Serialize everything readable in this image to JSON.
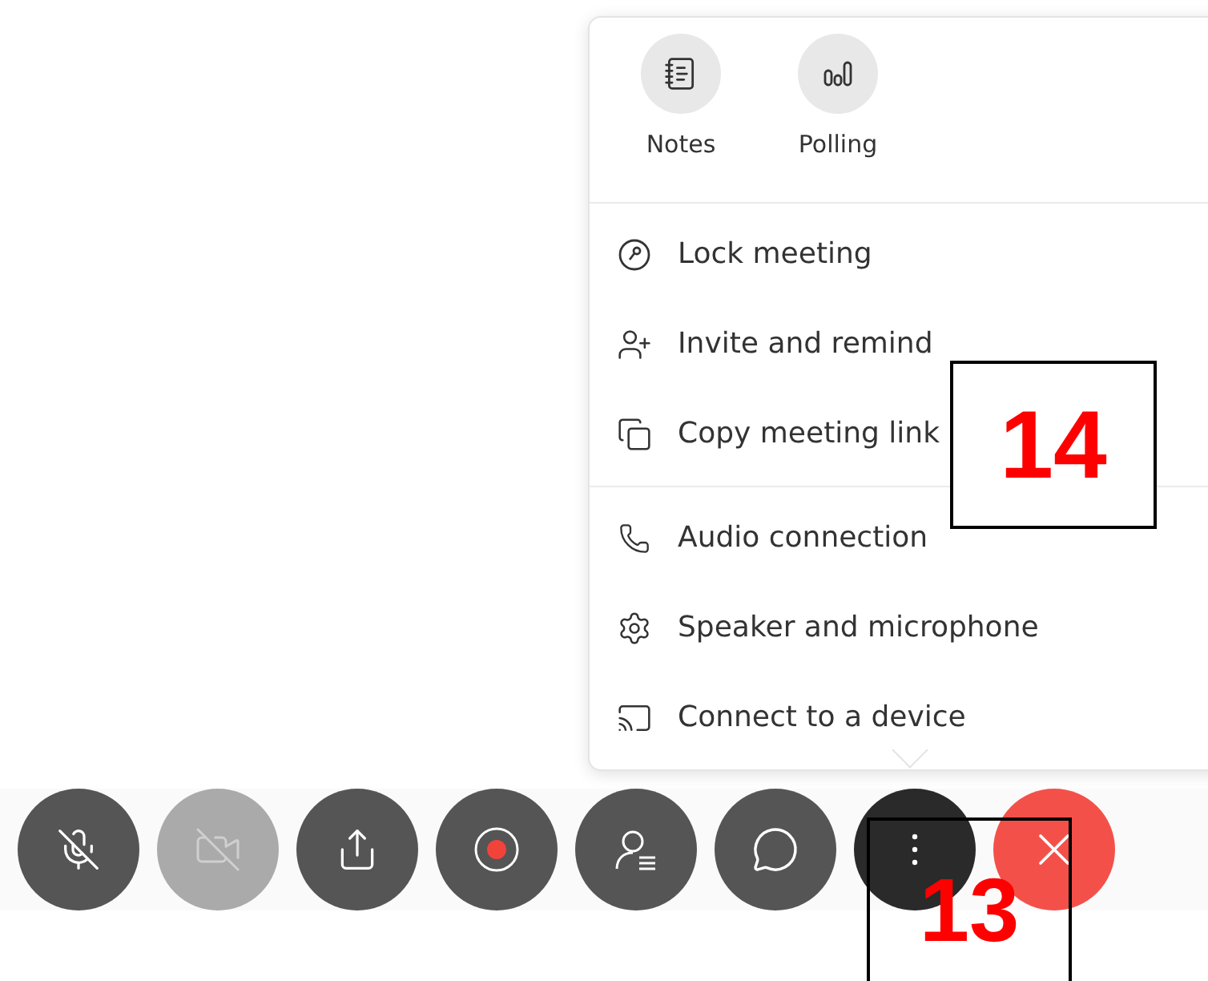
{
  "more_menu": {
    "apps": [
      {
        "kind": "notes",
        "label": "Notes"
      },
      {
        "kind": "polling",
        "label": "Polling"
      }
    ],
    "sections": [
      {
        "items": [
          {
            "kind": "lock",
            "label": "Lock meeting"
          },
          {
            "kind": "invite",
            "label": "Invite and remind"
          },
          {
            "kind": "copy",
            "label": "Copy meeting link"
          }
        ]
      },
      {
        "items": [
          {
            "kind": "audio",
            "label": "Audio connection"
          },
          {
            "kind": "settings",
            "label": "Speaker and microphone"
          },
          {
            "kind": "device",
            "label": "Connect to a device"
          }
        ]
      }
    ]
  },
  "toolbar": [
    {
      "kind": "mute",
      "disabled": false,
      "selected": false
    },
    {
      "kind": "video",
      "disabled": true,
      "selected": false
    },
    {
      "kind": "share",
      "disabled": false,
      "selected": false
    },
    {
      "kind": "record",
      "disabled": false,
      "selected": false
    },
    {
      "kind": "participants",
      "disabled": false,
      "selected": false
    },
    {
      "kind": "chat",
      "disabled": false,
      "selected": false
    },
    {
      "kind": "more",
      "disabled": false,
      "selected": true
    },
    {
      "kind": "leave",
      "disabled": false,
      "selected": false
    }
  ],
  "callouts": [
    {
      "label": "14"
    },
    {
      "label": "13"
    }
  ]
}
